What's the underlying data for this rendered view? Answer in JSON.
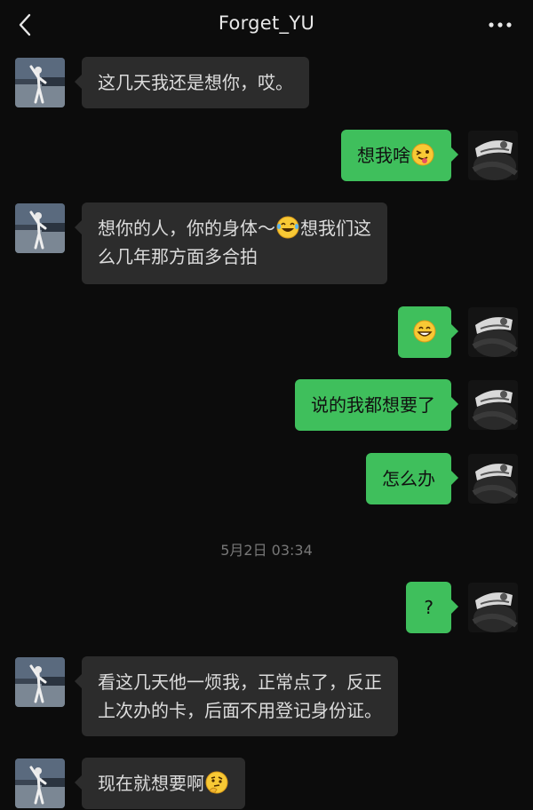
{
  "header": {
    "title": "Forget_YU"
  },
  "messages": [
    {
      "side": "in",
      "text1": "这几天我还是想你，哎。"
    },
    {
      "side": "out",
      "text1": "想我啥",
      "emoji": "face-tongue-emoji"
    },
    {
      "side": "in",
      "text1": "想你的人，你的身体～",
      "emoji": "laughing-tears-emoji",
      "text2": "想我们这",
      "text3": "么几年那方面多合拍"
    },
    {
      "side": "out",
      "emoji": "grinning-emoji"
    },
    {
      "side": "out",
      "text1": "说的我都想要了"
    },
    {
      "side": "out",
      "text1": "怎么办"
    },
    {
      "side": "out",
      "text1": "?"
    },
    {
      "side": "in",
      "text1": "看这几天他一烦我，正常点了，反正",
      "text2": "上次办的卡，后面不用登记身份证。"
    },
    {
      "side": "in",
      "text1": "现在就想要啊",
      "emoji": "thinking-emoji"
    }
  ],
  "timestamp": "5月2日 03:34",
  "colors": {
    "background": "#0c0c0c",
    "bubble_in": "#2c2c2c",
    "bubble_out": "#3fbf5c"
  }
}
